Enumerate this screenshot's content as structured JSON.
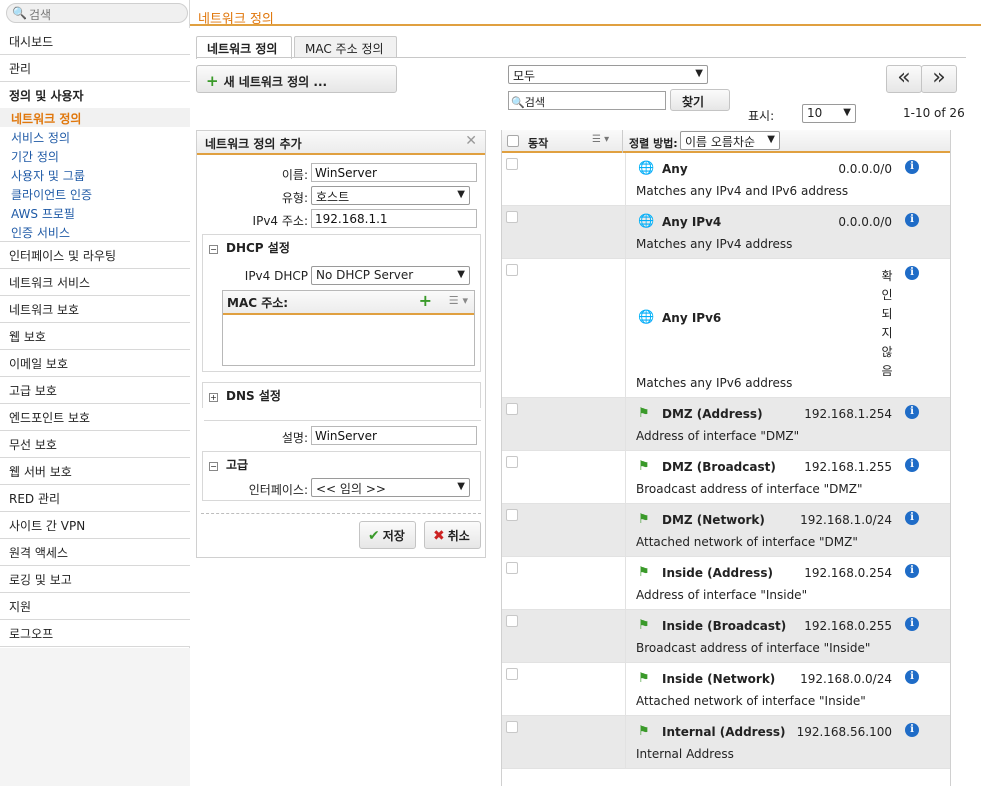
{
  "sidebar": {
    "search_placeholder": "검색",
    "items_top": [
      "대시보드",
      "관리",
      "정의 및 사용자"
    ],
    "sub_items": [
      "네트워크 정의",
      "서비스 정의",
      "기간 정의",
      "사용자 및 그룹",
      "클라이언트 인증",
      "AWS 프로필",
      "인증 서비스"
    ],
    "items_bottom": [
      "인터페이스 및 라우팅",
      "네트워크 서비스",
      "네트워크 보호",
      "웹 보호",
      "이메일 보호",
      "고급 보호",
      "엔드포인트 보호",
      "무선 보호",
      "웹 서버 보호",
      "RED 관리",
      "사이트 간 VPN",
      "원격 액세스",
      "로깅 및 보고",
      "지원",
      "로그오프"
    ]
  },
  "header": {
    "title": "네트워크 정의"
  },
  "tabs": [
    "네트워크 정의",
    "MAC 주소 정의"
  ],
  "toolbar": {
    "new_button": "새 네트워크 정의 ..."
  },
  "form": {
    "title": "네트워크 정의 추가",
    "name_label": "이름:",
    "name_value": "WinServer",
    "type_label": "유형:",
    "type_value": "호스트",
    "ipv4_label": "IPv4 주소:",
    "ipv4_value": "192.168.1.1",
    "dhcp_section": "DHCP 설정",
    "ipv4_dhcp_label": "IPv4 DHCP",
    "ipv4_dhcp_value": "No DHCP Server",
    "mac_label": "MAC 주소:",
    "dns_section": "DNS 설정",
    "desc_label": "설명:",
    "desc_value": "WinServer",
    "advanced_section": "고급",
    "interface_label": "인터페이스:",
    "interface_value": "<< 임의 >>",
    "save": "저장",
    "cancel": "취소"
  },
  "list_controls": {
    "filter_value": "모두",
    "search_placeholder": "검색",
    "find_button": "찾기",
    "prev": "«",
    "next": "»",
    "show_label": "표시:",
    "per_page": "10",
    "range": "1-10 of 26",
    "action_label": "동작",
    "sort_label": "정렬 방법:",
    "sort_value": "이름 오름차순"
  },
  "rows": [
    {
      "icon": "globe-icon",
      "name": "Any",
      "addr": "0.0.0.0/0",
      "desc": "Matches any IPv4 and IPv6 address"
    },
    {
      "icon": "globe-icon",
      "name": "Any IPv4",
      "addr": "0.0.0.0/0",
      "desc": "Matches any IPv4 address"
    },
    {
      "icon": "globe-icon",
      "name": "Any IPv6",
      "addr": "",
      "desc": "Matches any IPv6 address",
      "vertical_chars": [
        "확",
        "인",
        "되",
        "지",
        "않",
        "음"
      ]
    },
    {
      "icon": "flag-icon",
      "name": "DMZ (Address)",
      "addr": "192.168.1.254",
      "desc": "Address of interface \"DMZ\""
    },
    {
      "icon": "flag-icon",
      "name": "DMZ (Broadcast)",
      "addr": "192.168.1.255",
      "desc": "Broadcast address of interface \"DMZ\""
    },
    {
      "icon": "flag-icon",
      "name": "DMZ (Network)",
      "addr": "192.168.1.0/24",
      "desc": "Attached network of interface \"DMZ\""
    },
    {
      "icon": "flag-icon",
      "name": "Inside (Address)",
      "addr": "192.168.0.254",
      "desc": "Address of interface \"Inside\""
    },
    {
      "icon": "flag-icon",
      "name": "Inside (Broadcast)",
      "addr": "192.168.0.255",
      "desc": "Broadcast address of interface \"Inside\""
    },
    {
      "icon": "flag-icon",
      "name": "Inside (Network)",
      "addr": "192.168.0.0/24",
      "desc": "Attached network of interface \"Inside\""
    },
    {
      "icon": "flag-icon",
      "name": "Internal (Address)",
      "addr": "192.168.56.100",
      "desc": "Internal Address"
    }
  ],
  "colors": {
    "accent": "#e0770c",
    "link": "#1f5aa6",
    "info": "#1f6cc7",
    "add": "#3a9a2a"
  }
}
